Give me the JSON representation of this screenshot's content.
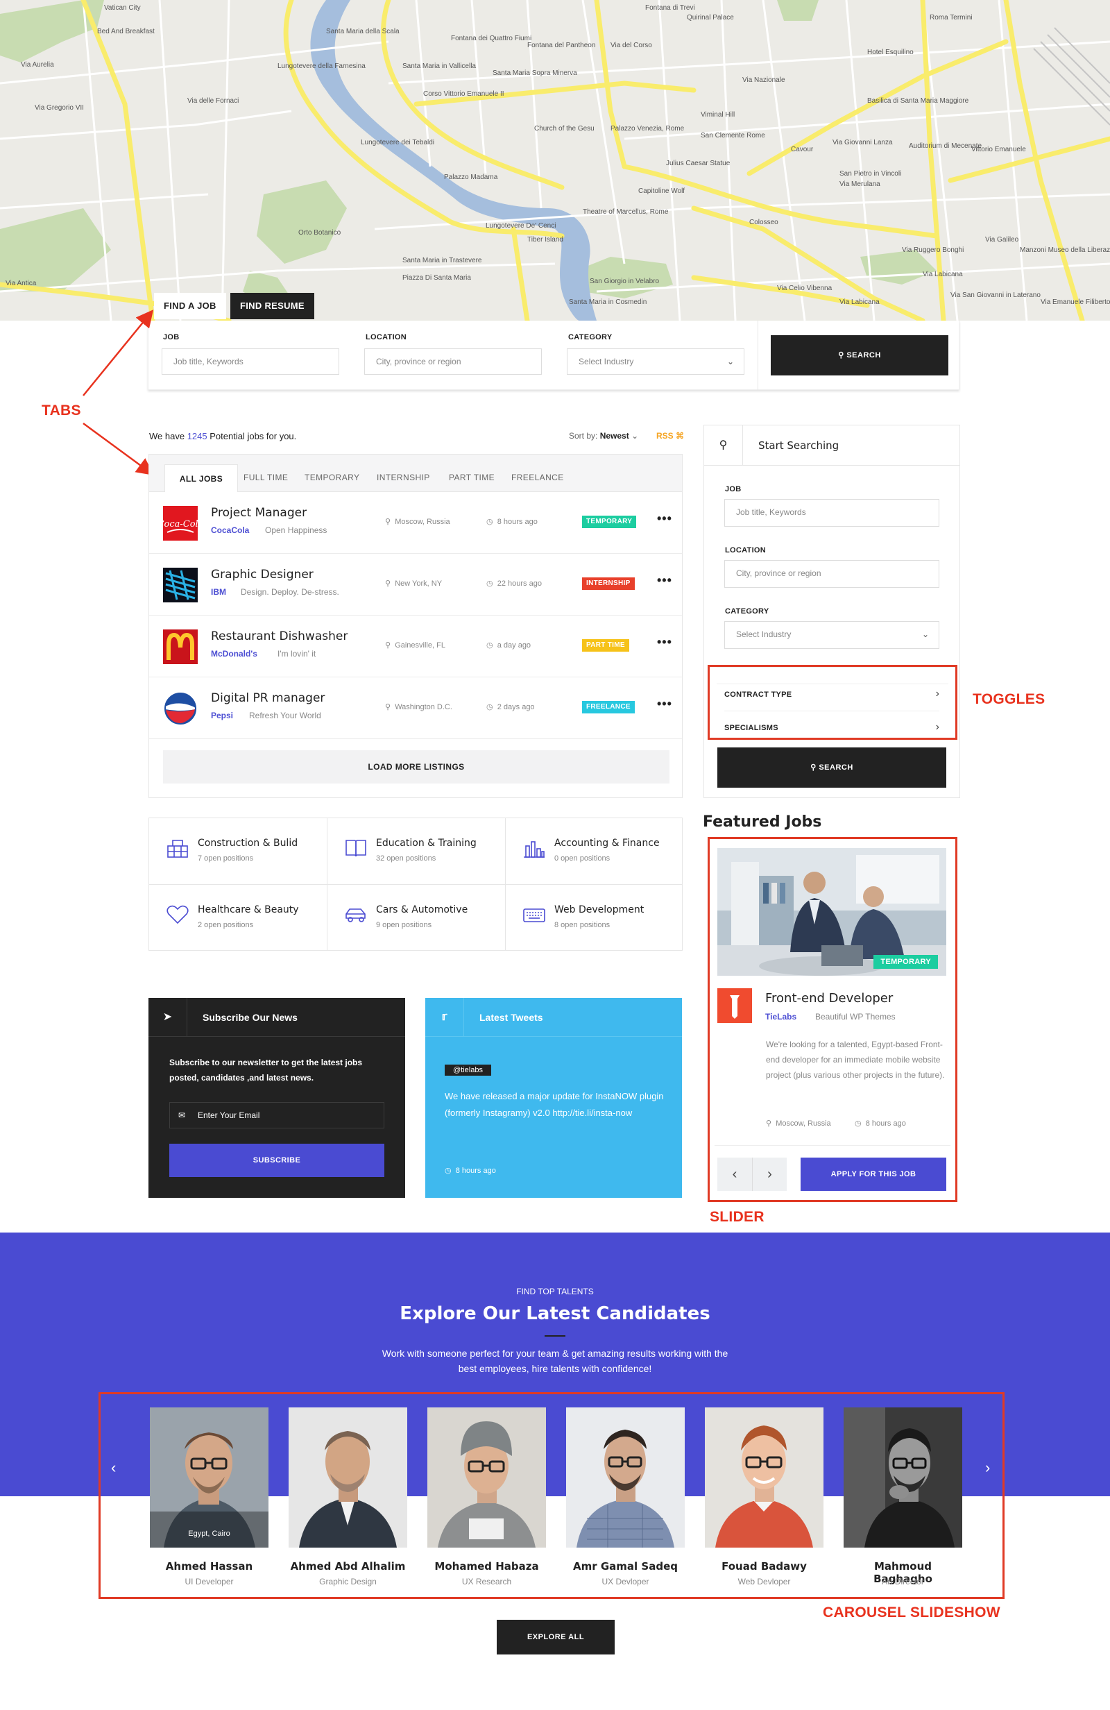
{
  "map": {
    "labels": [
      "Vatican City",
      "Via Aurelia",
      "Bed And Breakfast",
      "Via Gregorio VII",
      "Via delle Fornaci",
      "Orto Botanico",
      "Santa Maria della Scala",
      "Lungotevere della Farnesina",
      "Lungotevere dei Tebaldi",
      "Santa Maria in Vallicella",
      "Fontana dei Quattro Fiumi",
      "Corso Vittorio Emanuele II",
      "Church of the Gesu",
      "Santa Maria Sopra Minerva",
      "Fontana del Pantheon",
      "Palazzo Venezia, Rome",
      "Julius Caesar Statue",
      "Capitoline Wolf",
      "Theatre of Marcellus, Rome",
      "Tiber Island",
      "Santa Maria in Cosmedin",
      "Santa Maria in Trastevere",
      "Piazza Di Santa Maria",
      "Lungotevere De' Cenci",
      "San Giorgio in Velabro",
      "Via del Corso",
      "Quirinal Palace",
      "Via Nazionale",
      "Viminal Hill",
      "San Clemente Rome",
      "Colosseo",
      "Via Labicana",
      "Via Celio Vibenna",
      "Via Merulana",
      "Basilica di Santa Maria Maggiore",
      "Roma Termini",
      "Hotel Esquilino",
      "Auditorium di Mecenate",
      "Vittorio Emanuele",
      "Cavour",
      "San Pietro in Vincoli",
      "Via Giovanni Lanza",
      "Manzoni Museo della Liberazione",
      "Via Emanuele Filiberto",
      "Via Labicana",
      "Via Ruggero Bonghi",
      "Via Galileo",
      "Via San Giovanni in Laterano",
      "Fontana di Trevi",
      "Via Antica",
      "Palazzo Madama"
    ]
  },
  "search": {
    "tab_find_job": "FIND A JOB",
    "tab_find_resume": "FIND RESUME",
    "job_label": "JOB",
    "job_placeholder": "Job title, Keywords",
    "location_label": "LOCATION",
    "location_placeholder": "City, province or region",
    "category_label": "CATEGORY",
    "category_value": "Select Industry",
    "search_button": "SEARCH"
  },
  "annotations": {
    "tabs": "TABS",
    "toggles": "TOGGLES",
    "slider": "SLIDER",
    "carousel": "CAROUSEL SLIDESHOW"
  },
  "jobs": {
    "summary_prefix": "We have",
    "summary_count": "1245",
    "summary_suffix": "Potential jobs for you.",
    "sort_label": "Sort by:",
    "sort_value": "Newest",
    "rss": "RSS",
    "tabs": [
      "ALL JOBS",
      "FULL TIME",
      "TEMPORARY",
      "INTERNSHIP",
      "PART TIME",
      "FREELANCE"
    ],
    "items": [
      {
        "title": "Project Manager",
        "company": "CocaCola",
        "tagline": "Open Happiness",
        "location": "Moscow, Russia",
        "time": "8 hours ago",
        "type": "TEMPORARY"
      },
      {
        "title": "Graphic Designer",
        "company": "IBM",
        "tagline": "Design. Deploy. De-stress.",
        "location": "New York, NY",
        "time": "22 hours ago",
        "type": "INTERNSHIP"
      },
      {
        "title": "Restaurant Dishwasher",
        "company": "McDonald's",
        "tagline": "I'm lovin' it",
        "location": "Gainesville, FL",
        "time": "a day ago",
        "type": "PART TIME"
      },
      {
        "title": "Digital PR manager",
        "company": "Pepsi",
        "tagline": "Refresh Your World",
        "location": "Washington D.C.",
        "time": "2 days ago",
        "type": "FREELANCE"
      }
    ],
    "load_more": "LOAD MORE LISTINGS"
  },
  "categories": [
    {
      "name": "Construction & Bulid",
      "count": "7 open positions"
    },
    {
      "name": "Education & Training",
      "count": "32 open positions"
    },
    {
      "name": "Accounting & Finance",
      "count": "0 open positions"
    },
    {
      "name": "Healthcare & Beauty",
      "count": "2 open positions"
    },
    {
      "name": "Cars & Automotive",
      "count": "9 open positions"
    },
    {
      "name": "Web Development",
      "count": "8 open positions"
    }
  ],
  "sidebar": {
    "title": "Start Searching",
    "job_label": "JOB",
    "job_placeholder": "Job title, Keywords",
    "location_label": "LOCATION",
    "location_placeholder": "City, province or region",
    "category_label": "CATEGORY",
    "category_value": "Select Industry",
    "contract_type": "CONTRACT TYPE",
    "specialisms": "SPECIALISMS",
    "search_button": "SEARCH"
  },
  "featured": {
    "heading": "Featured Jobs",
    "badge": "TEMPORARY",
    "title": "Front-end Developer",
    "company": "TieLabs",
    "tagline": "Beautiful WP Themes",
    "description": "We're looking for a talented, Egypt-based Front-end developer for an immediate mobile website project (plus various other projects in the future).",
    "location": "Moscow, Russia",
    "time": "8 hours ago",
    "apply": "APPLY FOR THIS JOB"
  },
  "newsletter": {
    "title": "Subscribe Our News",
    "text": "Subscribe to our newsletter to get the latest jobs posted, candidates ,and latest news.",
    "email_placeholder": "Enter Your Email",
    "button": "SUBSCRIBE"
  },
  "tweets": {
    "title": "Latest Tweets",
    "handle": "@tielabs",
    "text": "We have released a major update for InstaNOW plugin (formerly Instagramy) v2.0 http://tie.li/insta-now",
    "time": "8 hours ago"
  },
  "candidates": {
    "eyebrow": "FIND TOP TALENTS",
    "heading": "Explore Our Latest Candidates",
    "text1": "Work with someone perfect for your team & get amazing results working with the",
    "text2": "best employees, hire talents with confidence!",
    "items": [
      {
        "name": "Ahmed Hassan",
        "role": "UI Developer",
        "overlay": "Egypt, Cairo"
      },
      {
        "name": "Ahmed Abd Alhalim",
        "role": "Graphic Design"
      },
      {
        "name": "Mohamed Habaza",
        "role": "UX Research"
      },
      {
        "name": "Amr Gamal Sadeq",
        "role": "UX Devloper"
      },
      {
        "name": "Fouad Badawy",
        "role": "Web Devloper"
      },
      {
        "name": "Mahmoud Baghagho",
        "role": "Art Director"
      }
    ],
    "explore_all": "EXPLORE ALL"
  },
  "colors": {
    "accent": "#4a4bd2",
    "annotation_red": "#e8321e",
    "temporary": "#1ccda0",
    "internship": "#e8402b",
    "part_time": "#f6c219",
    "freelance": "#27c8df",
    "tweets_bg": "#3fb9ee",
    "dark": "#222222"
  },
  "icons": [
    "search-icon",
    "map-marker-icon",
    "clock-icon",
    "chevron-down-icon",
    "chevron-right-icon",
    "chevron-left-icon",
    "paper-plane-icon",
    "twitter-icon",
    "envelope-icon",
    "more-dots-icon",
    "rss-icon"
  ]
}
